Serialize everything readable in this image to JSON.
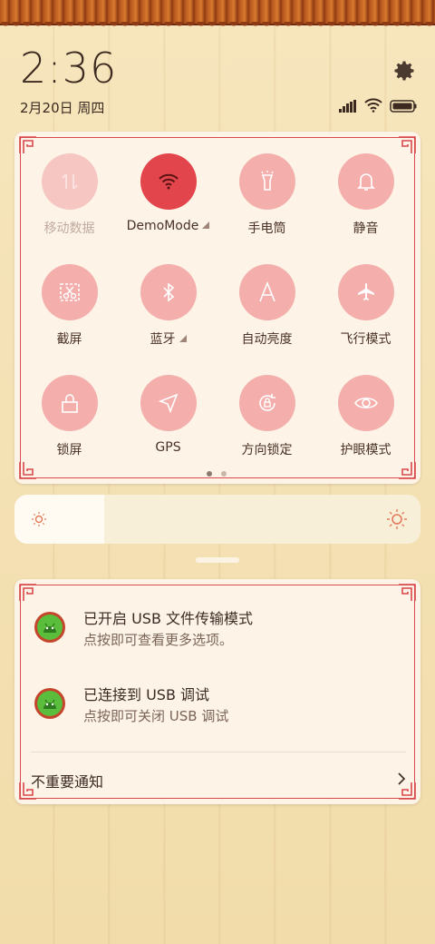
{
  "status_bar": {
    "time": "2:36",
    "date": "2月20日 周四"
  },
  "quick_settings": {
    "tiles": [
      {
        "label": "移动数据",
        "icon": "mobile-data-icon",
        "state": "disabled"
      },
      {
        "label": "DemoMode",
        "icon": "wifi-icon",
        "state": "active",
        "has_more": true
      },
      {
        "label": "手电筒",
        "icon": "flashlight-icon",
        "state": "off"
      },
      {
        "label": "静音",
        "icon": "bell-icon",
        "state": "off"
      },
      {
        "label": "截屏",
        "icon": "screenshot-icon",
        "state": "off"
      },
      {
        "label": "蓝牙",
        "icon": "bluetooth-icon",
        "state": "off",
        "has_more": true
      },
      {
        "label": "自动亮度",
        "icon": "auto-brightness-icon",
        "state": "off"
      },
      {
        "label": "飞行模式",
        "icon": "airplane-icon",
        "state": "off"
      },
      {
        "label": "锁屏",
        "icon": "lock-icon",
        "state": "off"
      },
      {
        "label": "GPS",
        "icon": "location-icon",
        "state": "off"
      },
      {
        "label": "方向锁定",
        "icon": "rotation-lock-icon",
        "state": "off"
      },
      {
        "label": "护眼模式",
        "icon": "eye-icon",
        "state": "off"
      }
    ],
    "page_index": 1,
    "page_count": 2
  },
  "brightness": {
    "level_fraction": 0.22
  },
  "notifications": [
    {
      "title": "已开启 USB 文件传输模式",
      "subtitle": "点按即可查看更多选项。",
      "icon": "android-icon"
    },
    {
      "title": "已连接到 USB 调试",
      "subtitle": "点按即可关闭 USB 调试",
      "icon": "android-icon"
    }
  ],
  "minor_notifications": {
    "label": "不重要通知"
  },
  "colors": {
    "accent_red": "#e2454b",
    "tile_pink": "#f4afac",
    "frame_red": "#d9484c"
  }
}
